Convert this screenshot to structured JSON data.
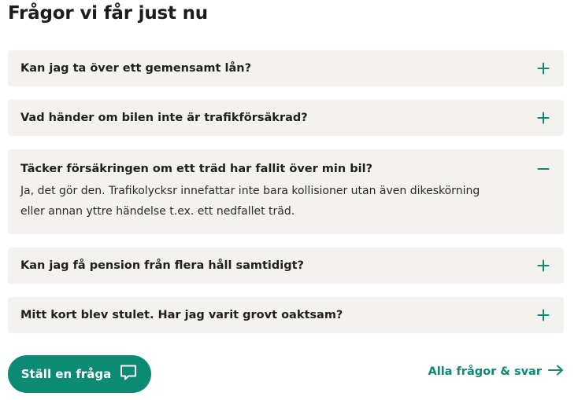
{
  "heading": "Frågor vi får just nu",
  "faq": [
    {
      "question": "Kan jag ta över ett gemensamt lån?",
      "open": false
    },
    {
      "question": "Vad händer om bilen inte är trafikförsäkrad?",
      "open": false
    },
    {
      "question": "Täcker försäkringen om ett träd har fallit över min bil?",
      "open": true,
      "answer_line1": "Ja, det gör den. Trafikolycksr innefattar inte bara kollisioner utan även dikeskörning",
      "answer_line2": "eller annan yttre händelse t.ex. ett nedfallet träd."
    },
    {
      "question": "Kan jag få pension från flera håll samtidigt?",
      "open": false
    },
    {
      "question": "Mitt kort blev stulet. Har jag varit grovt oaktsam?",
      "open": false
    }
  ],
  "ask_button": {
    "label": "Ställ en fråga",
    "icon": "chat-bubble-icon"
  },
  "all_link": {
    "label": "Alla frågor & svar",
    "icon": "arrow-right-icon"
  },
  "colors": {
    "accent": "#0d8a73",
    "card_bg": "#f3f2ef",
    "text": "#1f1f1f"
  }
}
